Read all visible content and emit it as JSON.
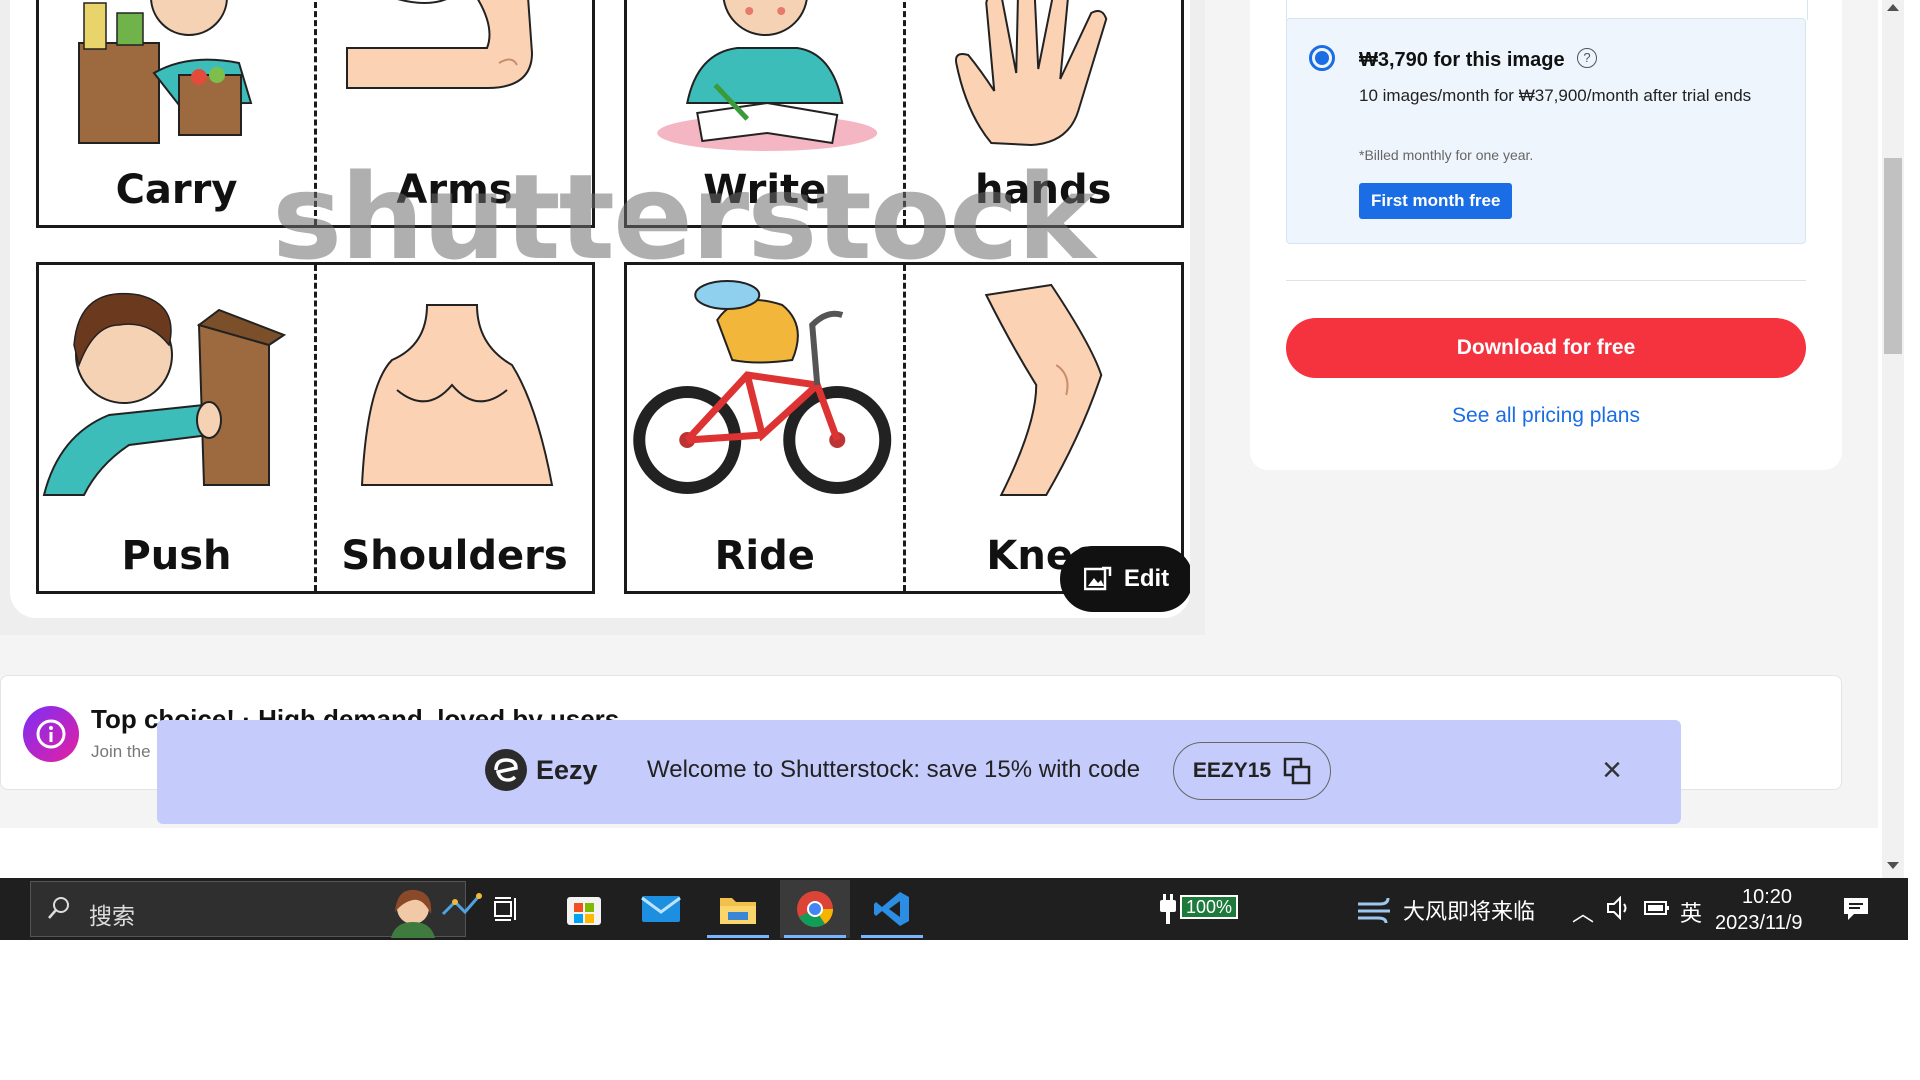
{
  "preview": {
    "cards": [
      {
        "left_word": "Carry",
        "right_word": "Arms"
      },
      {
        "left_word": "Write",
        "right_word": "hands"
      },
      {
        "left_word": "Push",
        "right_word": "Shoulders"
      },
      {
        "left_word": "Ride",
        "right_word": "Knee"
      }
    ],
    "watermark": "shutterstock",
    "edit_label": "Edit"
  },
  "pricing": {
    "plan_price": "₩3,790 for this image",
    "plan_desc": "10 images/month for ₩37,900/month after trial ends",
    "plan_note": "*Billed monthly for one year.",
    "trial_badge": "First month free",
    "download_label": "Download for free",
    "pricing_link": "See all pricing plans"
  },
  "top_choice": {
    "title": "Top choice! · High demand, loved by users",
    "subtitle": "Join the"
  },
  "promo": {
    "brand": "Eezy",
    "message": "Welcome to Shutterstock: save 15% with code",
    "code": "EEZY15"
  },
  "taskbar": {
    "search_placeholder": "搜索",
    "battery": "100%",
    "weather": "大风即将来临",
    "ime": "英",
    "time": "10:20",
    "date": "2023/11/9"
  },
  "colors": {
    "download_button": "#f5333f",
    "accent_blue": "#1a6de4",
    "promo_bg": "#c5ccfb",
    "taskbar_bg": "#1f1f1f"
  }
}
